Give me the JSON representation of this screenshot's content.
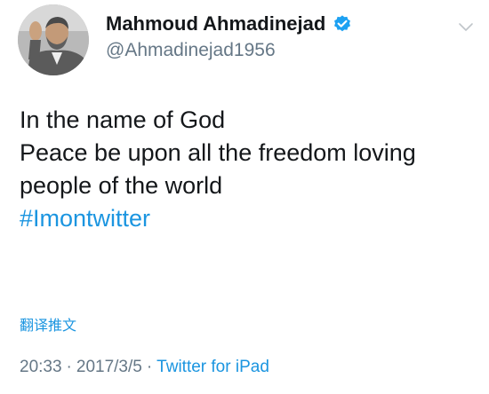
{
  "author": {
    "display_name": "Mahmoud Ahmadinejad",
    "handle": "@Ahmadinejad1956",
    "verified": true
  },
  "tweet": {
    "lines": [
      "In the name of God",
      "Peace be upon all the freedom loving",
      "people of the world"
    ],
    "hashtag": "#Imontwitter"
  },
  "translate_label": "翻译推文",
  "meta": {
    "time": "20:33",
    "date": "2017/3/5",
    "separator": "·",
    "source": "Twitter for iPad"
  },
  "icons": {
    "verified": "verified-badge-icon",
    "caret": "chevron-down-icon"
  },
  "colors": {
    "accent": "#1b95e0",
    "verified": "#1da1f2",
    "muted": "#657786",
    "text": "#14171a"
  }
}
